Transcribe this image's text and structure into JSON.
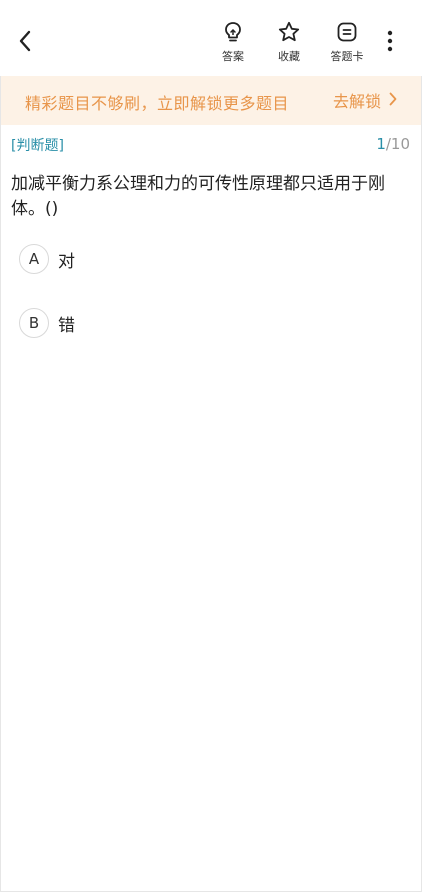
{
  "toolbar": {
    "answer_label": "答案",
    "favorite_label": "收藏",
    "card_label": "答题卡"
  },
  "icons": {
    "back": "chevron-left-icon",
    "answer": "lightbulb-icon",
    "favorite": "star-icon",
    "card": "answer-card-icon",
    "more": "more-vertical-icon",
    "banner_arrow": "chevron-right-icon"
  },
  "colors": {
    "accent": "#2a8fa8",
    "banner_bg": "#fdf2e6",
    "banner_text": "#e8954a"
  },
  "banner": {
    "text": "精彩题目不够刷，立即解锁更多题目",
    "link_label": "去解锁"
  },
  "question": {
    "type_label": "[判断题]",
    "current": "1",
    "total": "/10",
    "text": "加减平衡力系公理和力的可传性原理都只适用于刚体。()"
  },
  "options": [
    {
      "letter": "A",
      "text": "对"
    },
    {
      "letter": "B",
      "text": "错"
    }
  ]
}
